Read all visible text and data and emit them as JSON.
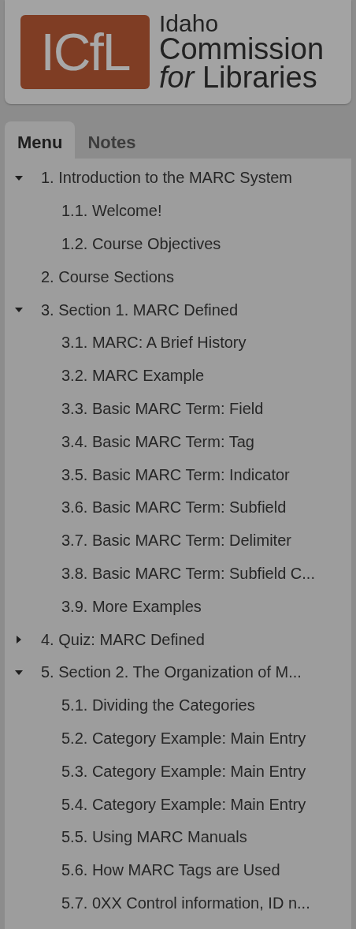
{
  "logo": {
    "mark": "ICfL",
    "lines": [
      "Idaho",
      "Commission",
      "*for* Libraries"
    ]
  },
  "tabs": [
    {
      "label": "Menu",
      "selected": true
    },
    {
      "label": "Notes",
      "selected": false
    }
  ],
  "menu": [
    {
      "label": "1. Introduction to the MARC System",
      "expanded": true,
      "children": [
        {
          "label": "1.1. Welcome!"
        },
        {
          "label": "1.2. Course Objectives"
        }
      ]
    },
    {
      "label": "2. Course Sections"
    },
    {
      "label": "3. Section 1. MARC Defined",
      "expanded": true,
      "children": [
        {
          "label": "3.1. MARC: A Brief History"
        },
        {
          "label": "3.2. MARC Example"
        },
        {
          "label": "3.3. Basic MARC Term: Field"
        },
        {
          "label": "3.4. Basic MARC Term: Tag"
        },
        {
          "label": "3.5. Basic MARC Term: Indicator"
        },
        {
          "label": "3.6. Basic MARC Term: Subfield"
        },
        {
          "label": "3.7. Basic MARC Term: Delimiter"
        },
        {
          "label": "3.8. Basic MARC Term: Subfield C..."
        },
        {
          "label": "3.9. More Examples"
        }
      ]
    },
    {
      "label": "4. Quiz: MARC Defined",
      "expanded": false
    },
    {
      "label": "5. Section 2. The Organization of M...",
      "expanded": true,
      "children": [
        {
          "label": "5.1. Dividing the Categories"
        },
        {
          "label": "5.2. Category Example: Main Entry"
        },
        {
          "label": "5.3. Category Example: Main Entry"
        },
        {
          "label": "5.4. Category Example: Main Entry"
        },
        {
          "label": "5.5. Using MARC Manuals"
        },
        {
          "label": "5.6. How MARC Tags are Used"
        },
        {
          "label": "5.7. 0XX Control information, ID n..."
        }
      ]
    }
  ]
}
